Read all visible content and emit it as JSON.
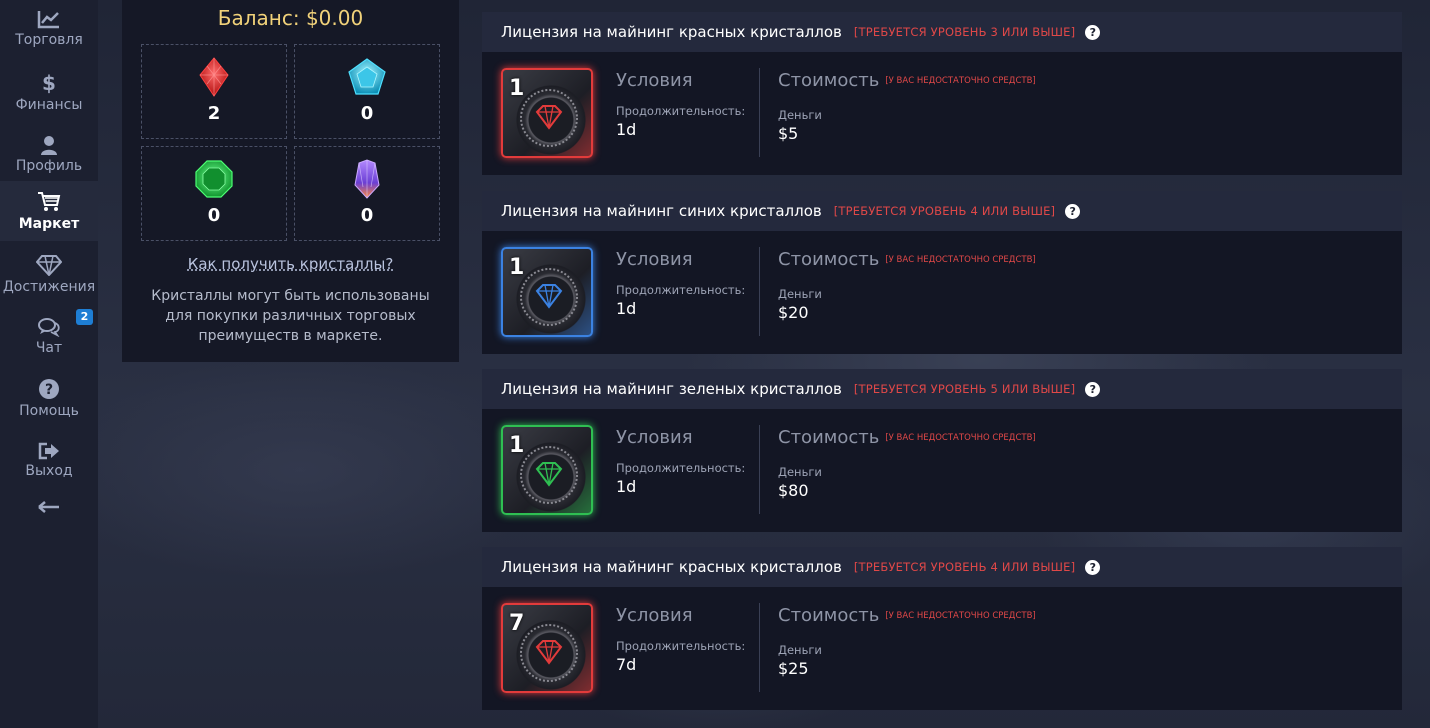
{
  "sidebar": {
    "items": [
      {
        "label": "Торговля",
        "icon": "chart-line-icon"
      },
      {
        "label": "Финансы",
        "icon": "dollar-icon"
      },
      {
        "label": "Профиль",
        "icon": "user-icon"
      },
      {
        "label": "Маркет",
        "icon": "cart-icon",
        "active": true
      },
      {
        "label": "Достижения",
        "icon": "diamond-icon"
      },
      {
        "label": "Чат",
        "icon": "chat-icon",
        "badge": "2"
      },
      {
        "label": "Помощь",
        "icon": "question-icon"
      },
      {
        "label": "Выход",
        "icon": "logout-icon"
      }
    ],
    "collapse_icon": "arrow-left-icon"
  },
  "crystals": {
    "balance": "Баланс: $0.00",
    "items": [
      {
        "type": "red",
        "count": "2"
      },
      {
        "type": "blue",
        "count": "0"
      },
      {
        "type": "green",
        "count": "0"
      },
      {
        "type": "purple",
        "count": "0"
      }
    ],
    "how_link": "Как получить кристаллы?",
    "description": "Кристаллы могут быть использованы для покупки различных торговых преимуществ в маркете."
  },
  "licenses": [
    {
      "title": "Лицензия на майнинг красных кристаллов",
      "requirement": "[ТРЕБУЕТСЯ УРОВЕНЬ 3 ИЛИ ВЫШЕ]",
      "image_number": "1",
      "color": "#e23b3b",
      "conditions_title": "Условия",
      "duration_label": "Продолжительность:",
      "duration": "1d",
      "cost_title": "Стоимость",
      "cost_warning": "[У ВАС НЕДОСТАТОЧНО СРЕДСТВ]",
      "money_label": "Деньги",
      "price": "$5"
    },
    {
      "title": "Лицензия на майнинг синих кристаллов",
      "requirement": "[ТРЕБУЕТСЯ УРОВЕНЬ 4 ИЛИ ВЫШЕ]",
      "image_number": "1",
      "color": "#3b82e2",
      "conditions_title": "Условия",
      "duration_label": "Продолжительность:",
      "duration": "1d",
      "cost_title": "Стоимость",
      "cost_warning": "[У ВАС НЕДОСТАТОЧНО СРЕДСТВ]",
      "money_label": "Деньги",
      "price": "$20"
    },
    {
      "title": "Лицензия на майнинг зеленых кристаллов",
      "requirement": "[ТРЕБУЕТСЯ УРОВЕНЬ 5 ИЛИ ВЫШЕ]",
      "image_number": "1",
      "color": "#2fbf52",
      "conditions_title": "Условия",
      "duration_label": "Продолжительность:",
      "duration": "1d",
      "cost_title": "Стоимость",
      "cost_warning": "[У ВАС НЕДОСТАТОЧНО СРЕДСТВ]",
      "money_label": "Деньги",
      "price": "$80"
    },
    {
      "title": "Лицензия на майнинг красных кристаллов",
      "requirement": "[ТРЕБУЕТСЯ УРОВЕНЬ 4 ИЛИ ВЫШЕ]",
      "image_number": "7",
      "color": "#e23b3b",
      "conditions_title": "Условия",
      "duration_label": "Продолжительность:",
      "duration": "7d",
      "cost_title": "Стоимость",
      "cost_warning": "[У ВАС НЕДОСТАТОЧНО СРЕДСТВ]",
      "money_label": "Деньги",
      "price": "$25"
    }
  ],
  "colors": {
    "accent_gold": "#f1d27a",
    "warning_red": "#e04848",
    "badge_blue": "#1e7ed4"
  }
}
